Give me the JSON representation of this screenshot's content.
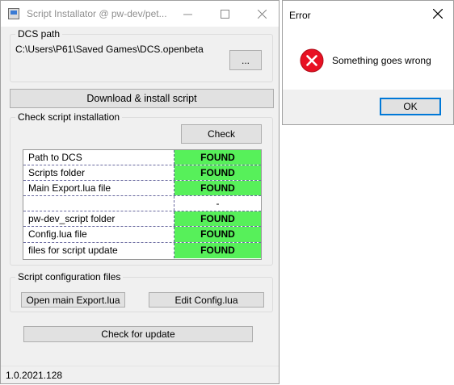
{
  "main_window": {
    "title": "Script Installator @ pw-dev/pet...",
    "dcs_path": {
      "group_title": "DCS path",
      "value": "C:\\Users\\P61\\Saved Games\\DCS.openbeta",
      "browse_label": "..."
    },
    "download_button": "Download & install script",
    "check_install": {
      "group_title": "Check script installation",
      "check_button": "Check",
      "rows": [
        {
          "name": "Path to DCS",
          "status": "FOUND"
        },
        {
          "name": "Scripts folder",
          "status": "FOUND"
        },
        {
          "name": "Main Export.lua file",
          "status": "FOUND"
        },
        {
          "name": "",
          "status": "-"
        },
        {
          "name": "pw-dev_script folder",
          "status": "FOUND"
        },
        {
          "name": "Config.lua file",
          "status": "FOUND"
        },
        {
          "name": "files for script update",
          "status": "FOUND"
        }
      ]
    },
    "config_files": {
      "group_title": "Script configuration files",
      "open_export_button": "Open main Export.lua",
      "edit_config_button": "Edit Config.lua"
    },
    "check_update_button": "Check for update",
    "version": "1.0.2021.128"
  },
  "error_dialog": {
    "title": "Error",
    "message": "Something goes wrong",
    "ok_label": "OK"
  },
  "colors": {
    "found": "#57f05a",
    "accent": "#0078d7",
    "error_icon": "#e81123"
  },
  "icons": {
    "app": "app-window-icon",
    "error": "error-x-circle-icon"
  }
}
